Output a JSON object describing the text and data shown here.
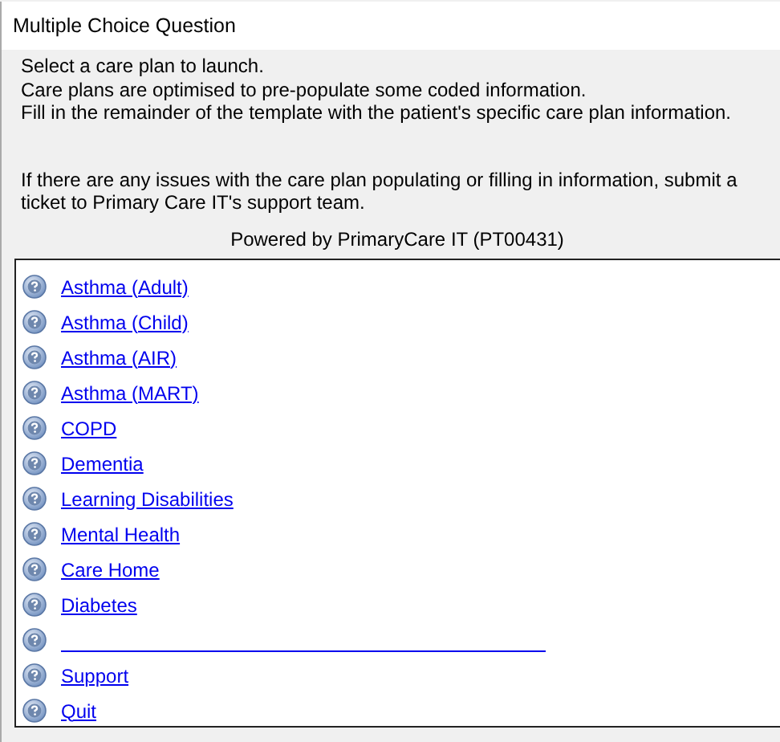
{
  "window": {
    "title": "Multiple Choice Question"
  },
  "intro": [
    "Select a care plan to launch.",
    "Care plans are optimised to pre-populate some coded information.",
    "Fill in the remainder of the template with the patient's specific care plan information."
  ],
  "note": "If there are any issues with the care plan populating or filling in information, submit a ticket to Primary Care IT's support team.",
  "powered_by": "Powered by PrimaryCare IT (PT00431)",
  "options": [
    {
      "kind": "link",
      "label": "Asthma (Adult)"
    },
    {
      "kind": "link",
      "label": "Asthma (Child)"
    },
    {
      "kind": "link",
      "label": "Asthma (AIR)"
    },
    {
      "kind": "link",
      "label": "Asthma (MART)"
    },
    {
      "kind": "link",
      "label": "COPD"
    },
    {
      "kind": "link",
      "label": "Dementia"
    },
    {
      "kind": "link",
      "label": "Learning Disabilities"
    },
    {
      "kind": "link",
      "label": "Mental Health"
    },
    {
      "kind": "link",
      "label": "Care Home"
    },
    {
      "kind": "link",
      "label": "Diabetes"
    },
    {
      "kind": "blank"
    },
    {
      "kind": "link",
      "label": "Support"
    },
    {
      "kind": "link",
      "label": "Quit"
    }
  ]
}
